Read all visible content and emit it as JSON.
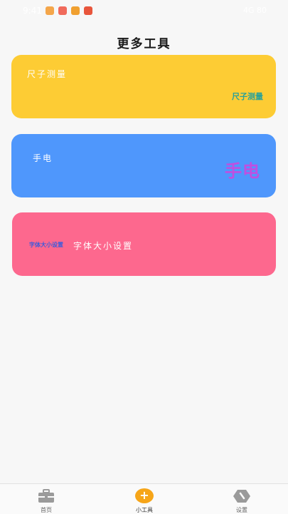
{
  "status_bar": {
    "time": "9:41",
    "right_text": "4G 80",
    "icon_colors": [
      "#f4a64a",
      "#f06a5b",
      "#f0a030",
      "#e8553c"
    ]
  },
  "page": {
    "title": "更多工具"
  },
  "cards": {
    "ruler": {
      "label": "尺子测量",
      "logo": "尺子测量",
      "color": "#fdcc34"
    },
    "flashlight": {
      "label": "手电",
      "logo": "手电",
      "color": "#4f97fc"
    },
    "font_size": {
      "label": "字体大小设置",
      "logo": "字体大小设置",
      "color": "#fd688e"
    }
  },
  "tabbar": {
    "home": {
      "label": "首页",
      "icon": "toolbox-icon"
    },
    "tools": {
      "label": "小工具",
      "icon": "plus-icon",
      "active": true
    },
    "settings": {
      "label": "设置",
      "icon": "settings-icon"
    }
  }
}
